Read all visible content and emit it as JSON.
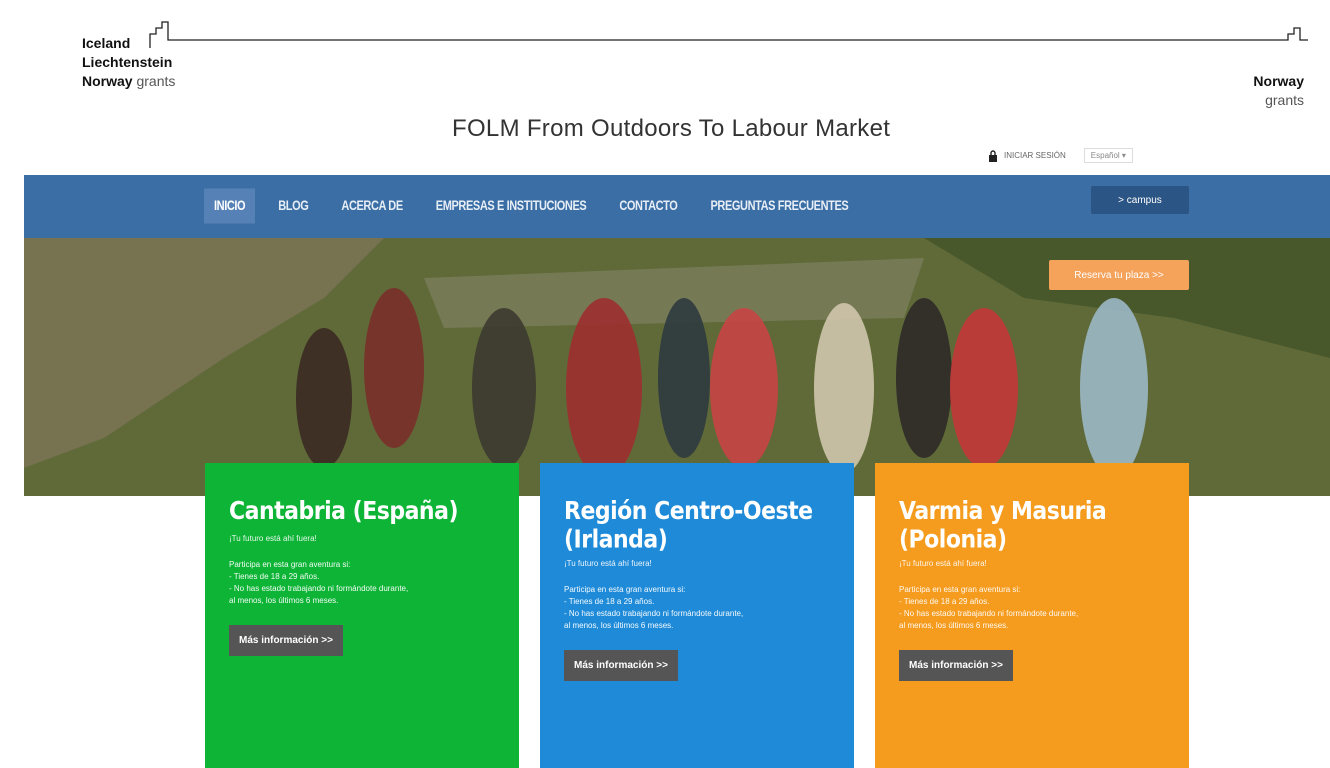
{
  "grants": {
    "left_lines": [
      "Iceland",
      "Liechtenstein",
      "Norway"
    ],
    "left_suffix": "grants",
    "right_top": "Norway",
    "right_bottom": "grants"
  },
  "site": {
    "title": "FOLM From Outdoors To Labour Market"
  },
  "util": {
    "login": "INICIAR SESIÓN",
    "language": "Español ▾"
  },
  "nav": {
    "items": [
      "Inicio",
      "Blog",
      "Acerca de",
      "Empresas e instituciones",
      "Contacto",
      "Preguntas frecuentes"
    ],
    "active_index": 0,
    "campus": "> campus"
  },
  "hero": {
    "reserve": "Reserva tu plaza >>"
  },
  "cards": [
    {
      "title": "Cantabria (España)",
      "tag": "¡Tu futuro está ahí fuera!",
      "body": [
        "Participa en esta gran aventura si:",
        "- Tienes de 18 a 29 años.",
        "- No has estado trabajando ni formándote durante,",
        "al menos, los últimos 6 meses."
      ],
      "more": "Más información >>",
      "color": "#0db436"
    },
    {
      "title": "Región Centro-Oeste (Irlanda)",
      "tag": "¡Tu futuro está ahí fuera!",
      "body": [
        "Participa en esta gran aventura si:",
        "- Tienes de 18 a 29 años.",
        "- No has estado trabajando ni formándote durante,",
        "al menos, los últimos 6 meses."
      ],
      "more": "Más información >>",
      "color": "#1f8bd8"
    },
    {
      "title": "Varmia y Masuria (Polonia)",
      "tag": "¡Tu futuro está ahí fuera!",
      "body": [
        "Participa en esta gran aventura si:",
        "- Tienes de 18 a 29 años.",
        "- No has estado trabajando ni formándote durante,",
        "al menos, los últimos 6 meses."
      ],
      "more": "Más información >>",
      "color": "#f59b1d"
    }
  ],
  "colors": {
    "nav_bg": "#3a6ea5",
    "reserve": "#f5a25b"
  }
}
